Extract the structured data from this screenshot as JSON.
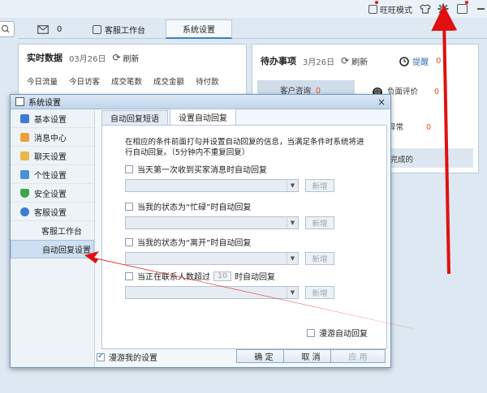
{
  "topbar": {
    "wangwang_mode": "旺旺模式",
    "icons": [
      "wangwang-mode-icon",
      "shirt-icon",
      "gear-icon",
      "mail-icon",
      "minimize-icon"
    ]
  },
  "tabs": {
    "message_count": "0",
    "service_workbench": "客服工作台",
    "system_settings": "系统设置"
  },
  "realtime": {
    "title": "实时数据",
    "date": "03月26日",
    "refresh": "刷新",
    "stats": [
      "今日流量",
      "今日访客",
      "成交笔数",
      "成交金额",
      "待付款"
    ]
  },
  "todo": {
    "title": "待办事项",
    "date": "3月26日",
    "refresh": "刷新",
    "reminder": "提醒",
    "reminder_count": "0",
    "row1_label": "客户咨询",
    "row1_count": "0",
    "row2_label": "负面评价",
    "row2_count": "0",
    "row3_label": "物流异常",
    "row3_count": "0",
    "row4_label": "未完成的"
  },
  "dialog": {
    "title": "系统设置",
    "close": "×",
    "nav": [
      {
        "label": "基本设置",
        "color": "#3a7bd5"
      },
      {
        "label": "消息中心",
        "color": "#e9a23b"
      },
      {
        "label": "聊天设置",
        "color": "#e9b84a"
      },
      {
        "label": "个性设置",
        "color": "#4a90d9"
      },
      {
        "label": "安全设置",
        "color": "#3aa84a"
      },
      {
        "label": "客服设置",
        "color": "#3a7bd5"
      }
    ],
    "nav_sub": [
      "客服工作台",
      "自动回复设置"
    ],
    "content_tabs": [
      "自动回复短语",
      "设置自动回复"
    ],
    "description": "在相应的条件前面打勾并设置自动回复的信息，当满足条件时系统将进行自动回复。（5分钟内不重复回复）",
    "options": [
      {
        "label": "当天第一次收到买家消息时自动回复",
        "checked": false
      },
      {
        "label": "当我的状态为“忙碌”时自动回复",
        "checked": false
      },
      {
        "label": "当我的状态为“离开”时自动回复",
        "checked": false
      }
    ],
    "option4_prefix": "当正在联系人数超过",
    "option4_value": "10",
    "option4_suffix": "时自动回复",
    "new_button": "新增",
    "roaming_autoreply": "漫游自动回复",
    "roaming_settings": "漫游我的设置",
    "roaming_settings_checked": true,
    "ok": "确 定",
    "cancel": "取 消",
    "apply": "应 用"
  },
  "colors": {
    "annotation_red": "#e01010",
    "accent_blue": "#3b7fd1"
  }
}
